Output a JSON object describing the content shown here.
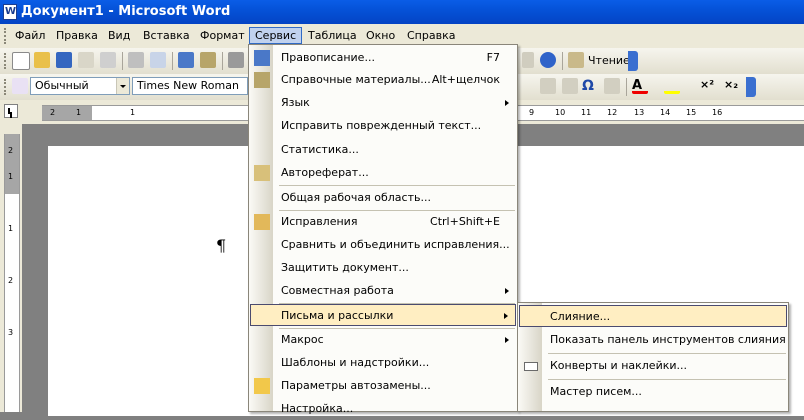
{
  "window": {
    "title": "Документ1 - Microsoft Word"
  },
  "menubar": {
    "items": [
      {
        "label": "Файл"
      },
      {
        "label": "Правка"
      },
      {
        "label": "Вид"
      },
      {
        "label": "Вставка"
      },
      {
        "label": "Формат"
      },
      {
        "label": "Сервис"
      },
      {
        "label": "Таблица"
      },
      {
        "label": "Окно"
      },
      {
        "label": "Справка"
      }
    ],
    "active": "Сервис"
  },
  "standard_toolbar": {
    "reading_label": "Чтение"
  },
  "formatting_toolbar": {
    "style_value": "Обычный",
    "font_value": "Times New Roman"
  },
  "ruler": {
    "numbers": [
      "2",
      "1",
      "1",
      "9",
      "10",
      "11",
      "12",
      "13",
      "14",
      "15",
      "16"
    ]
  },
  "vruler": {
    "numbers": [
      "2",
      "1",
      "1",
      "2",
      "3"
    ]
  },
  "document": {
    "pilcrow": "¶"
  },
  "tools_menu": {
    "items": [
      {
        "label": "Правописание...",
        "shortcut": "F7",
        "icon": "spelling-icon"
      },
      {
        "label": "Справочные материалы...",
        "shortcut": "Alt+щелчок",
        "icon": "research-icon"
      },
      {
        "label": "Язык",
        "submenu": true
      },
      {
        "label": "Исправить поврежденный текст..."
      },
      {
        "label": "Статистика..."
      },
      {
        "label": "Автореферат...",
        "icon": "autosummary-icon"
      },
      {
        "label": "Общая рабочая область..."
      },
      {
        "label": "Исправления",
        "shortcut": "Ctrl+Shift+E",
        "icon": "track-changes-icon"
      },
      {
        "label": "Сравнить и объединить исправления..."
      },
      {
        "label": "Защитить документ..."
      },
      {
        "label": "Совместная работа",
        "submenu": true
      },
      {
        "label": "Письма и рассылки",
        "submenu": true,
        "highlighted": true
      },
      {
        "label": "Макрос",
        "submenu": true
      },
      {
        "label": "Шаблоны и надстройки..."
      },
      {
        "label": "Параметры автозамены...",
        "icon": "autocorrect-icon"
      },
      {
        "label": "Настройка..."
      }
    ]
  },
  "mail_submenu": {
    "items": [
      {
        "label": "Слияние...",
        "highlighted": true
      },
      {
        "label": "Показать панель инструментов слияния"
      },
      {
        "label": "Конверты и наклейки...",
        "icon": "envelope-icon"
      },
      {
        "label": "Мастер писем..."
      }
    ]
  },
  "colors": {
    "title_bar": "#0552d8",
    "menu_highlight": "#ffeec2",
    "menubar_active": "#c1d2ee"
  }
}
